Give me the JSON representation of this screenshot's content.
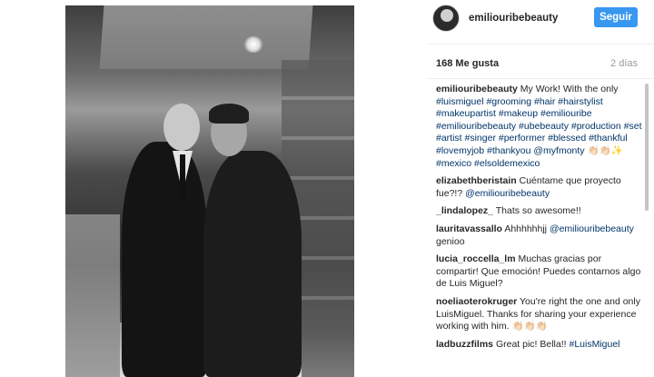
{
  "post": {
    "username": "emiliouribebeauty",
    "follow_label": "Seguir",
    "likes": "168 Me gusta",
    "time_ago": "2 días",
    "photo_alt": "Black and white photo of two men in a kitchen"
  },
  "comments": [
    {
      "user": "emiliouribebeauty",
      "segments": [
        {
          "t": "My Work! With the only ",
          "tag": false
        },
        {
          "t": "#luismiguel #grooming #hair #hairstylist #makeupartist #makeup #emiliouribe #emiliouribebeauty #ubebeauty #production #set #artist #singer #performer #blessed #thankful #lovemyjob #thankyou @myfmonty",
          "tag": true
        },
        {
          "t": " 👏🏻👏🏻✨ ",
          "tag": false
        },
        {
          "t": "#mexico #elsoldemexico",
          "tag": true
        }
      ]
    },
    {
      "user": "elizabethberistain",
      "segments": [
        {
          "t": "Cuéntame que proyecto fue?!? ",
          "tag": false
        },
        {
          "t": "@emiliouribebeauty",
          "tag": true
        }
      ]
    },
    {
      "user": "_lindalopez_",
      "segments": [
        {
          "t": "Thats so awesome!!",
          "tag": false
        }
      ]
    },
    {
      "user": "lauritavassallo",
      "segments": [
        {
          "t": "Ahhhhhhjj ",
          "tag": false
        },
        {
          "t": "@emiliouribebeauty",
          "tag": true
        },
        {
          "t": " genioo",
          "tag": false
        }
      ]
    },
    {
      "user": "lucia_roccella_lm",
      "segments": [
        {
          "t": "Muchas gracias por compartir! Que emoción! Puedes contarnos algo de Luis Miguel?",
          "tag": false
        }
      ]
    },
    {
      "user": "noeliaoterokruger",
      "segments": [
        {
          "t": "You're right the one and only LuisMiguel. Thanks for sharing your experience working with him. 👏🏻👏🏻👏🏻",
          "tag": false
        }
      ]
    },
    {
      "user": "ladbuzzfilms",
      "segments": [
        {
          "t": "Great pic! Bella!! ",
          "tag": false
        },
        {
          "t": "#LuisMiguel",
          "tag": true
        }
      ]
    }
  ],
  "colors": {
    "accent": "#3897f0",
    "link": "#003569",
    "muted": "#999999"
  }
}
